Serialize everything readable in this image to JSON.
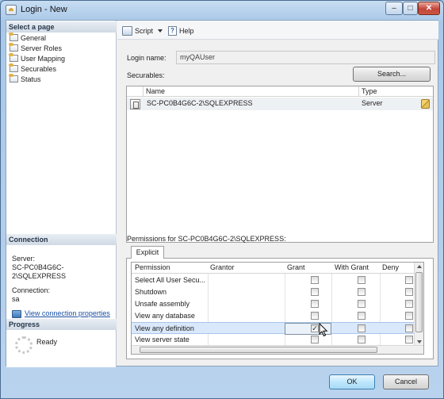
{
  "window": {
    "title": "Login - New",
    "controls": [
      "–",
      "□",
      "✕"
    ]
  },
  "left_pane": {
    "select_page_header": "Select a page",
    "pages": [
      {
        "label": "General"
      },
      {
        "label": "Server Roles"
      },
      {
        "label": "User Mapping"
      },
      {
        "label": "Securables"
      },
      {
        "label": "Status"
      }
    ],
    "connection_header": "Connection",
    "server_label": "Server:",
    "server_value": "SC-PC0B4G6C-2\\SQLEXPRESS",
    "connection_label": "Connection:",
    "connection_value": "sa",
    "view_connection_link": "View connection properties",
    "progress_header": "Progress",
    "progress_status": "Ready"
  },
  "toolbar": {
    "script_label": "Script",
    "help_label": "Help"
  },
  "form": {
    "login_name_label": "Login name:",
    "login_name_value": "myQAUser",
    "securables_label": "Securables:",
    "search_button": "Search..."
  },
  "securables_grid": {
    "columns": [
      "Name",
      "Type"
    ],
    "rows": [
      {
        "name": "SC-PC0B4G6C-2\\SQLEXPRESS",
        "type": "Server"
      }
    ]
  },
  "permissions": {
    "title": "Permissions for SC-PC0B4G6C-2\\SQLEXPRESS:",
    "tab_label": "Explicit",
    "columns": [
      "Permission",
      "Grantor",
      "Grant",
      "With Grant",
      "Deny"
    ],
    "rows": [
      {
        "permission": "Select All User Secu...",
        "grantor": "",
        "grant": false,
        "with_grant": false,
        "deny": false
      },
      {
        "permission": "Shutdown",
        "grantor": "",
        "grant": false,
        "with_grant": false,
        "deny": false
      },
      {
        "permission": "Unsafe assembly",
        "grantor": "",
        "grant": false,
        "with_grant": false,
        "deny": false
      },
      {
        "permission": "View any database",
        "grantor": "",
        "grant": false,
        "with_grant": false,
        "deny": false
      },
      {
        "permission": "View any definition",
        "grantor": "",
        "grant": true,
        "with_grant": false,
        "deny": false
      },
      {
        "permission": "View server state",
        "grantor": "",
        "grant": false,
        "with_grant": false,
        "deny": false
      }
    ],
    "selected_row_index": 4
  },
  "footer": {
    "ok_button": "OK",
    "cancel_button": "Cancel"
  }
}
